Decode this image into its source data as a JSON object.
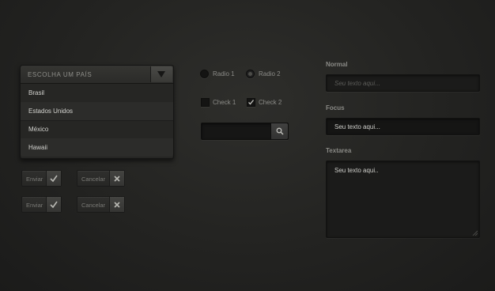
{
  "dropdown": {
    "label": "ESCOLHA UM PAÍS",
    "options": [
      "Brasil",
      "Estados Unidos",
      "México",
      "Hawaii"
    ]
  },
  "buttons": [
    {
      "label": "Enviar",
      "icon": "check-icon"
    },
    {
      "label": "Cancelar",
      "icon": "close-icon"
    },
    {
      "label": "Enviar",
      "icon": "check-icon"
    },
    {
      "label": "Cancelar",
      "icon": "close-icon"
    }
  ],
  "radios": [
    {
      "label": "Radio 1",
      "selected": false
    },
    {
      "label": "Radio 2",
      "selected": true
    }
  ],
  "checkboxes": [
    {
      "label": "Check 1",
      "checked": false
    },
    {
      "label": "Check 2",
      "checked": true
    }
  ],
  "search": {
    "value": "",
    "icon": "search-icon"
  },
  "fields": {
    "normal": {
      "label": "Normal",
      "placeholder": "Seu texto aqui..."
    },
    "focus": {
      "label": "Focus",
      "value": "Seu texto aqui..."
    },
    "textarea": {
      "label": "Textarea",
      "value": "Seu texto aqui.."
    }
  },
  "colors": {
    "background": "#232321",
    "panel": "#262624",
    "text": "#d3d3cf",
    "muted": "#8c8c88"
  }
}
